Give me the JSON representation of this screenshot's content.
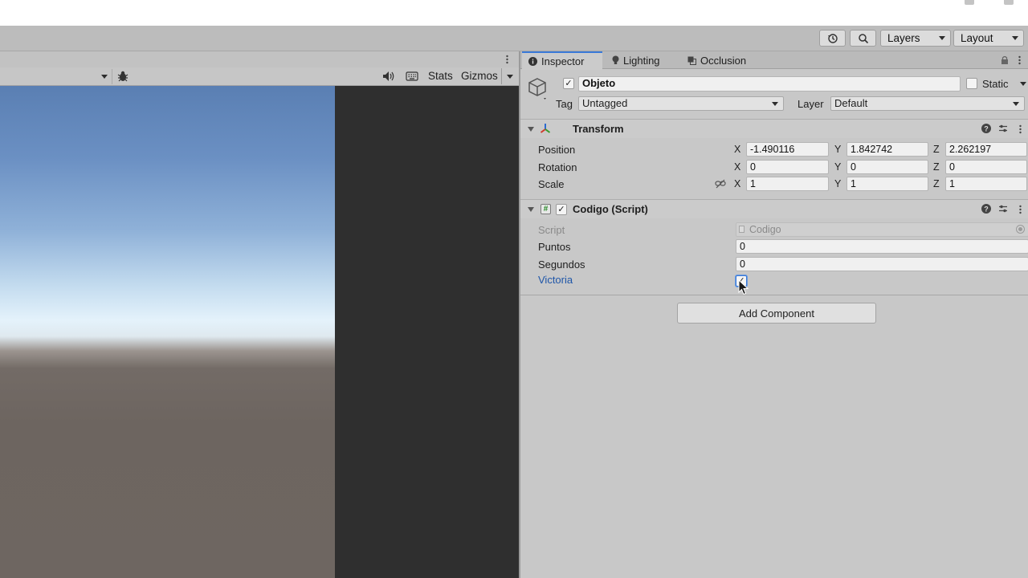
{
  "toolbar": {
    "layers_label": "Layers",
    "layout_label": "Layout"
  },
  "game": {
    "stats_label": "Stats",
    "gizmos_label": "Gizmos"
  },
  "inspector": {
    "tabs": [
      {
        "label": "Inspector",
        "icon": "info-icon"
      },
      {
        "label": "Lighting",
        "icon": "bulb-icon"
      },
      {
        "label": "Occlusion",
        "icon": "occlusion-icon"
      }
    ],
    "object_name": "Objeto",
    "static_label": "Static",
    "tag_label": "Tag",
    "tag_value": "Untagged",
    "layer_label": "Layer",
    "layer_value": "Default"
  },
  "transform": {
    "title": "Transform",
    "rows": [
      {
        "label": "Position",
        "x": "-1.490116",
        "y": "1.842742",
        "z": "2.262197"
      },
      {
        "label": "Rotation",
        "x": "0",
        "y": "0",
        "z": "0"
      },
      {
        "label": "Scale",
        "x": "1",
        "y": "1",
        "z": "1"
      }
    ],
    "axis_x": "X",
    "axis_y": "Y",
    "axis_z": "Z"
  },
  "script_component": {
    "title": "Codigo (Script)",
    "script_label": "Script",
    "script_value": "Codigo",
    "fields": [
      {
        "label": "Puntos",
        "value": "0"
      },
      {
        "label": "Segundos",
        "value": "0"
      }
    ],
    "victoria_label": "Victoria",
    "victoria_checked": true
  },
  "add_component_label": "Add Component",
  "colors": {
    "accent": "#3a79d8",
    "panel": "#c8c8c8",
    "toolbar": "#bcbcbc",
    "link_label": "#1f56a8"
  }
}
